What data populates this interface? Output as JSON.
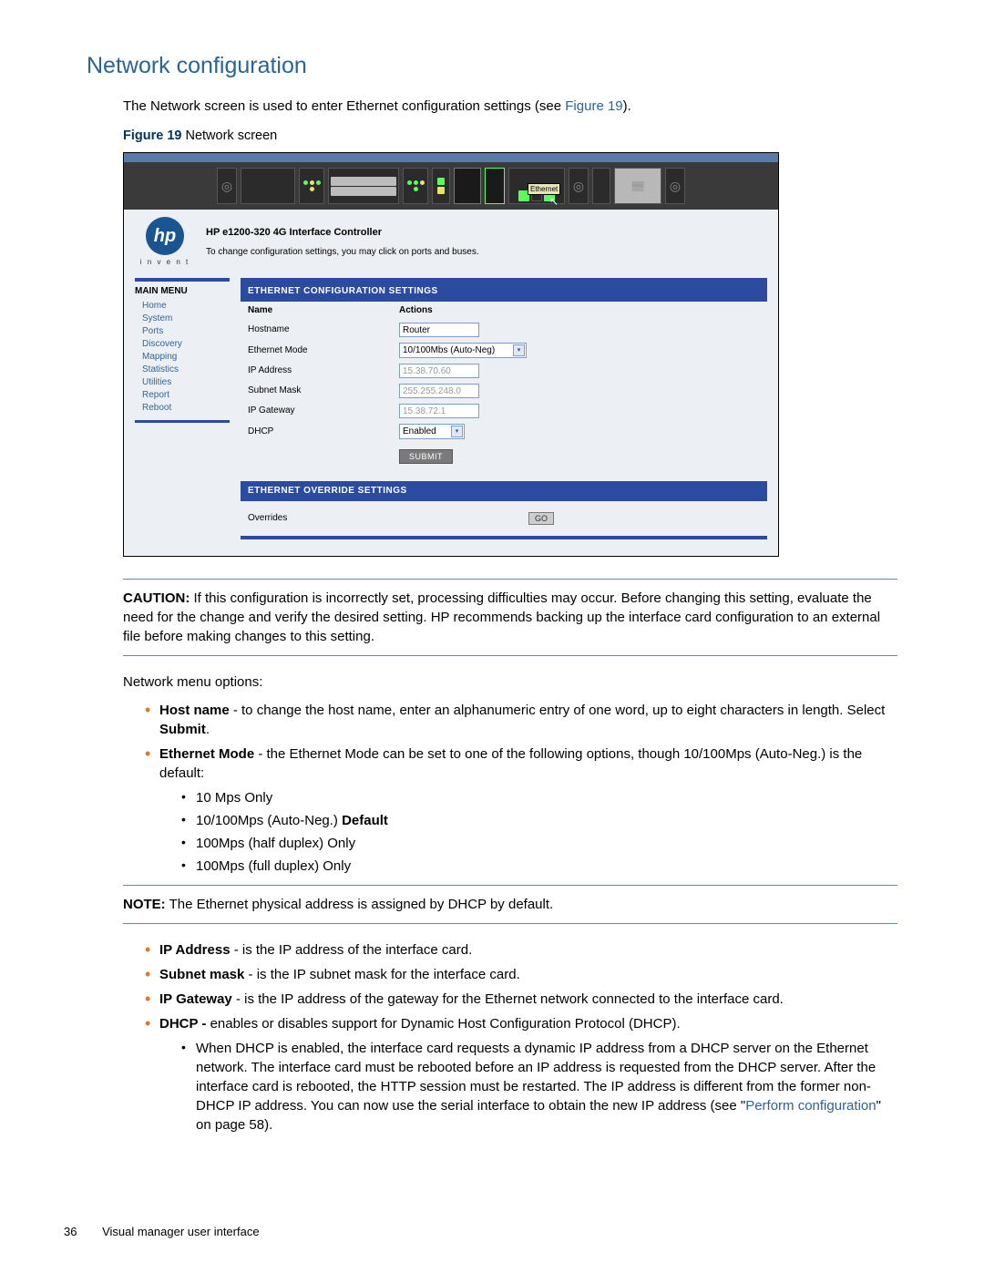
{
  "heading": "Network configuration",
  "intro": "The Network screen is used to enter Ethernet configuration settings (see ",
  "intro_ref": "Figure 19",
  "intro_after": ").",
  "figure": {
    "label": "Figure 19",
    "text": " Network screen"
  },
  "screenshot": {
    "eth_label": "Ethernet",
    "product_line": "HP e1200-320 4G Interface Controller",
    "instruction_line": "To change configuration settings, you may click on ports and buses.",
    "logo_text": "hp",
    "invent_text": "i n v e n t",
    "menu": {
      "title": "MAIN MENU",
      "items": [
        "Home",
        "System",
        "Ports",
        "Discovery",
        "Mapping",
        "Statistics",
        "Utilities",
        "Report",
        "Reboot"
      ]
    },
    "sec1": {
      "title": "ETHERNET CONFIGURATION SETTINGS",
      "col1": "Name",
      "col2": "Actions",
      "rows": [
        {
          "label": "Hostname",
          "value": "Router",
          "type": "input"
        },
        {
          "label": "Ethernet Mode",
          "value": "10/100Mbs (Auto-Neg)",
          "type": "select"
        },
        {
          "label": "IP Address",
          "value": "15.38.70.60",
          "type": "input-dis"
        },
        {
          "label": "Subnet Mask",
          "value": "255.255.248.0",
          "type": "input-dis"
        },
        {
          "label": "IP Gateway",
          "value": "15.38.72.1",
          "type": "input-dis"
        },
        {
          "label": "DHCP",
          "value": "Enabled",
          "type": "select-sm"
        }
      ],
      "submit": "SUBMIT"
    },
    "sec2": {
      "title": "ETHERNET OVERRIDE SETTINGS",
      "label": "Overrides",
      "go": "GO"
    }
  },
  "caution": {
    "lead": "CAUTION:",
    "text": "   If this configuration is incorrectly set, processing difficulties may occur. Before changing this setting, evaluate the need for the change and verify the desired setting. HP recommends backing up the interface card configuration to an external file before making changes to this setting."
  },
  "menu_options_intro": "Network menu options:",
  "list1": {
    "item1_lead": "Host name",
    "item1_text": " - to change the host name, enter an alphanumeric entry of one word, up to eight characters in length. Select ",
    "item1_bold": "Submit",
    "item1_after": ".",
    "item2_lead": "Ethernet Mode",
    "item2_text": " - the Ethernet Mode can be set to one of the following options, though 10/100Mps (Auto-Neg.) is the default:",
    "sub": [
      "10 Mps Only",
      "10/100Mps (Auto-Neg.) ",
      "100Mps (half duplex) Only",
      "100Mps (full duplex) Only"
    ],
    "sub_default": "Default"
  },
  "note": {
    "lead": "NOTE:",
    "text": "   The Ethernet physical address is assigned by DHCP by default."
  },
  "list2": {
    "item1_lead": "IP Address",
    "item1_text": " - is the IP address of the interface card.",
    "item2_lead": "Subnet mask",
    "item2_text": " - is the IP subnet mask for the interface card.",
    "item3_lead": "IP Gateway",
    "item3_text": " - is the IP address of the gateway for the Ethernet network connected to the interface card.",
    "item4_lead": "DHCP - ",
    "item4_text": "enables or disables support for Dynamic Host Configuration Protocol (DHCP).",
    "nested_pre": "When DHCP is enabled, the interface card requests a dynamic IP address from a DHCP server on the Ethernet network. The interface card must be rebooted before an IP address is requested from the DHCP server. After the interface card is rebooted, the HTTP session must be restarted. The IP address is different from the former non-DHCP IP address. You can now use the serial interface to obtain the new IP address (see \"",
    "nested_link": "Perform configuration",
    "nested_post": "\" on page 58)."
  },
  "footer": {
    "page": "36",
    "title": "Visual manager user interface"
  }
}
